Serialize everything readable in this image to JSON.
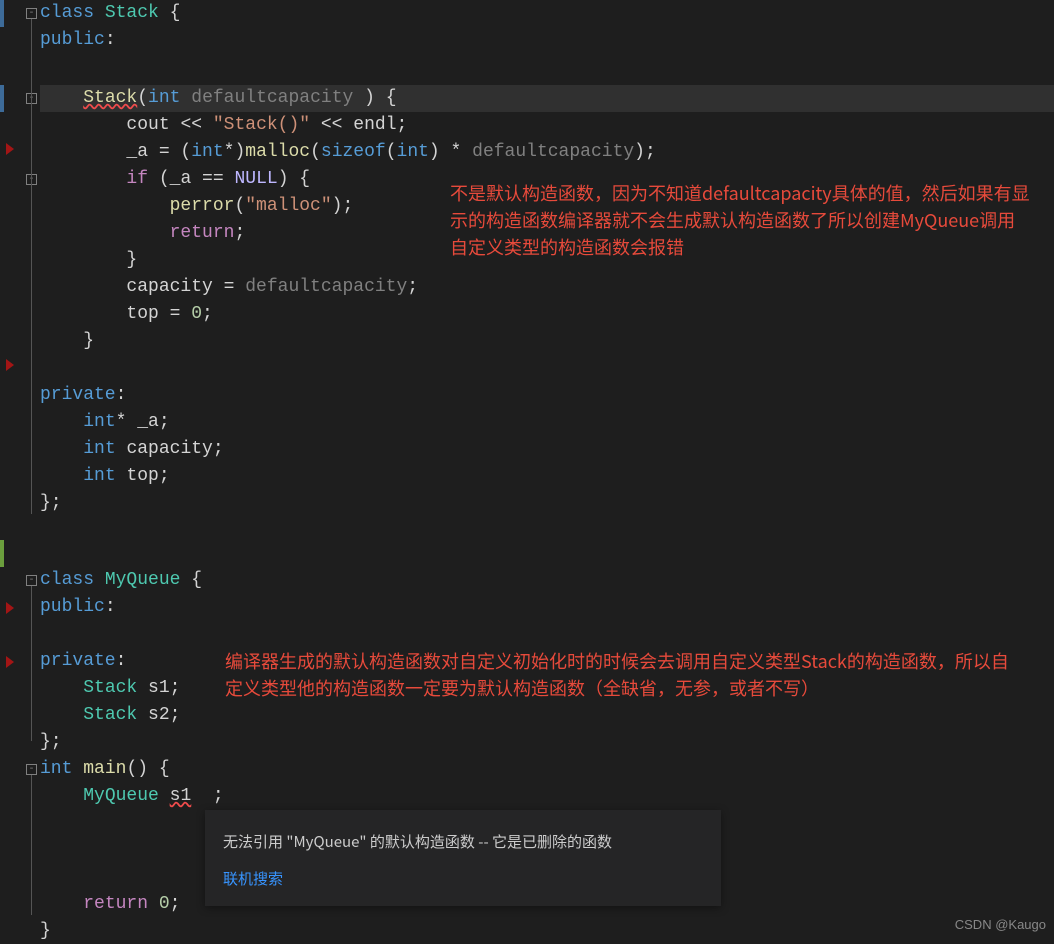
{
  "code": {
    "l1": {
      "kw1": "class",
      "cls": "Stack",
      "br": " {"
    },
    "l2": {
      "acc": "public",
      ":": ":"
    },
    "l3": "",
    "l4": {
      "pre": "    ",
      "fn": "Stack",
      "p1": "(",
      "kw": "int",
      "sp": " ",
      "arg": "defaultcapacity",
      "end": " ) { "
    },
    "l5": {
      "pre": "        ",
      "a": "cout",
      "op1": " << ",
      "s": "\"Stack()\"",
      "op2": " << ",
      "b": "endl",
      ";": ";"
    },
    "l6": {
      "pre": "        ",
      "v": "_a",
      "eq": " = (",
      "kw1": "int",
      "star": "*)",
      "fn": "malloc",
      "p1": "(",
      "kw2": "sizeof",
      "p2": "(",
      "kw3": "int",
      "p3": ") * ",
      "arg": "defaultcapacity",
      "end": ");"
    },
    "l7": {
      "pre": "        ",
      "kw": "if",
      "p1": " (",
      "v": "_a",
      "op": " == ",
      "nul": "NULL",
      "end": ") {"
    },
    "l8": {
      "pre": "            ",
      "fn": "perror",
      "p1": "(",
      "s": "\"malloc\"",
      "end": ");"
    },
    "l9": {
      "pre": "            ",
      "kw": "return",
      ";": ";"
    },
    "l10": {
      "pre": "        ",
      "br": "}"
    },
    "l11": {
      "pre": "        ",
      "v1": "capacity",
      "eq": " = ",
      "v2": "defaultcapacity",
      ";": ";"
    },
    "l12": {
      "pre": "        ",
      "v": "top",
      "eq": " = ",
      "n": "0",
      ";": ";"
    },
    "l13": {
      "pre": "    ",
      "br": "}"
    },
    "l14": "",
    "l15": {
      "acc": "private",
      ":": ":"
    },
    "l16": {
      "pre": "    ",
      "kw": "int",
      "star": "* ",
      "v": "_a",
      ";": ";"
    },
    "l17": {
      "pre": "    ",
      "kw": "int",
      "sp": " ",
      "v": "capacity",
      ";": ";"
    },
    "l18": {
      "pre": "    ",
      "kw": "int",
      "sp": " ",
      "v": "top",
      ";": ";"
    },
    "l19": {
      "br": "};"
    },
    "l20": "",
    "l21": {
      "kw1": "class",
      "cls": "MyQueue",
      "br": " {"
    },
    "l22": {
      "acc": "public",
      ":": ":"
    },
    "l23": "",
    "l24": {
      "acc": "private",
      ":": ":"
    },
    "l25": {
      "pre": "    ",
      "t": "Stack",
      "sp": " ",
      "v": "s1",
      ";": ";"
    },
    "l26": {
      "pre": "    ",
      "t": "Stack",
      "sp": " ",
      "v": "s2",
      ";": ";"
    },
    "l27": {
      "br": "};"
    },
    "l28": {
      "kw": "int",
      "sp": " ",
      "fn": "main",
      "p": "()",
      "br": " {"
    },
    "l29": {
      "pre": "    ",
      "t": "MyQueue",
      "sp": " ",
      "v": "s1",
      "sp2": "  ",
      ";": ";"
    },
    "l30": "",
    "l31": "",
    "l32": "",
    "l33": {
      "pre": "    ",
      "kw": "return",
      "sp": " ",
      "n": "0",
      ";": ";"
    },
    "l34": {
      "br": "}"
    }
  },
  "anno": {
    "a1": "不是默认构造函数，因为不知道defaultcapacity具体的值，然后如果有显示的构造函数编译器就不会生成默认构造函数了所以创建MyQueue调用自定义类型的构造函数会报错",
    "a2": "编译器生成的默认构造函数对自定义初始化时的时候会去调用自定义类型Stack的构造函数，所以自定义类型他的构造函数一定要为默认构造函数（全缺省，无参，或者不写）"
  },
  "tooltip": {
    "msg": "无法引用 \"MyQueue\" 的默认构造函数 -- 它是已删除的函数",
    "search": "联机搜索"
  },
  "watermark": "CSDN @Kaugo",
  "fold": {
    "minus": "-"
  }
}
